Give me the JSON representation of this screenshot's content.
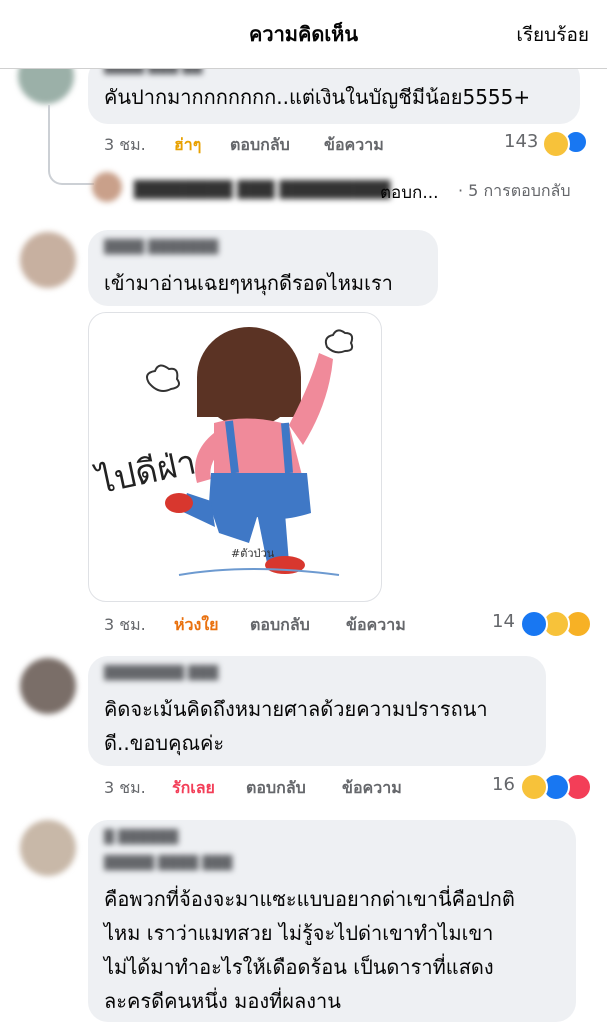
{
  "header": {
    "title": "ความคิดเห็น",
    "done_label": "เรียบร้อย"
  },
  "comments": [
    {
      "text": "คันปากมากกกกกกก..แต่เงินในบัญชีมีน้อย5555+",
      "time": "3 ชม.",
      "reaction_word": "ฮ่าๆ",
      "reply": "ตอบกลับ",
      "message": "ข้อความ",
      "count": "143",
      "reply_preview": "ตอบก...",
      "reply_count": "· 5 การตอบกลับ"
    },
    {
      "text": "เข้ามาอ่านเฉยๆหนุกดีรอดไหมเรา",
      "sticker_text": "ไปดีฝ่า",
      "sticker_tag": "#ตัวป่วน",
      "time": "3 ชม.",
      "reaction_word": "ห่วงใย",
      "reply": "ตอบกลับ",
      "message": "ข้อความ",
      "count": "14"
    },
    {
      "text_line1": "คิดจะเม้นคิดถึงหมายศาลด้วยความปรารถนา",
      "text_line2": "ดี..ขอบคุณค่ะ",
      "time": "3 ชม.",
      "reaction_word": "รักเลย",
      "reply": "ตอบกลับ",
      "message": "ข้อความ",
      "count": "16"
    },
    {
      "text_line1": "คือพวกที่จ้องจะมาแซะแบบอยากด่าเขานี่คือปกติ",
      "text_line2": "ไหม    เราว่าแมทสวย ไม่รู้จะไปด่าเขาทำไมเขา",
      "text_line3": "ไม่ได้มาทำอะไรให้เดือดร้อน เป็นดาราที่แสดง",
      "text_line4": "ละครดีคนหนึ่ง มองที่ผลงาน"
    }
  ],
  "colors": {
    "haha": "#e8a100",
    "care": "#e9710f",
    "love": "#f33e58"
  }
}
